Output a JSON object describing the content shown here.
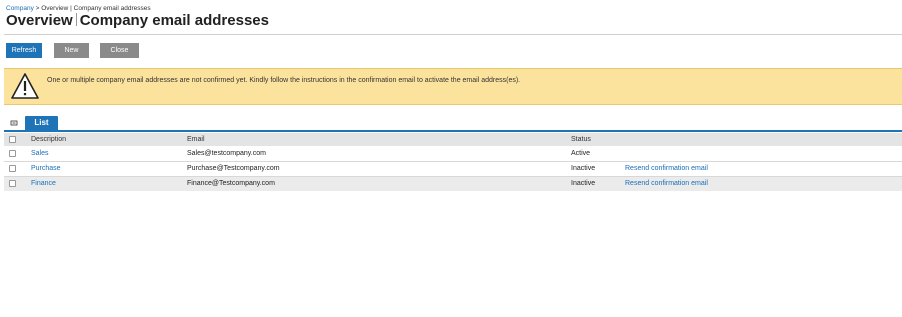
{
  "breadcrumb": {
    "root": "Company",
    "separator": ">",
    "trail": "Overview | Company email addresses"
  },
  "title": {
    "part1": "Overview",
    "part2": "Company email addresses"
  },
  "toolbar": {
    "refresh_label": "Refresh",
    "new_label": "New",
    "close_label": "Close"
  },
  "alert": {
    "icon": "warning-icon",
    "text": "One or multiple company email addresses are not confirmed yet. Kindly follow the instructions in the confirmation email to activate the email address(es)."
  },
  "tabs": {
    "toggle_icon": "collapse-toggle-icon",
    "list_label": "List"
  },
  "table": {
    "columns": {
      "description": "Description",
      "email": "Email",
      "status": "Status"
    },
    "rows": [
      {
        "description": "Sales",
        "email": "Sales@testcompany.com",
        "status": "Active",
        "action": ""
      },
      {
        "description": "Purchase",
        "email": "Purchase@Testcompany.com",
        "status": "Inactive",
        "action": "Resend confirmation email"
      },
      {
        "description": "Finance",
        "email": "Finance@Testcompany.com",
        "status": "Inactive",
        "action": "Resend confirmation email"
      }
    ]
  },
  "colors": {
    "accent": "#1f73b7",
    "link": "#1a6fb5",
    "alert_background": "#fce39d",
    "secondary_button": "#8a8a8a"
  }
}
